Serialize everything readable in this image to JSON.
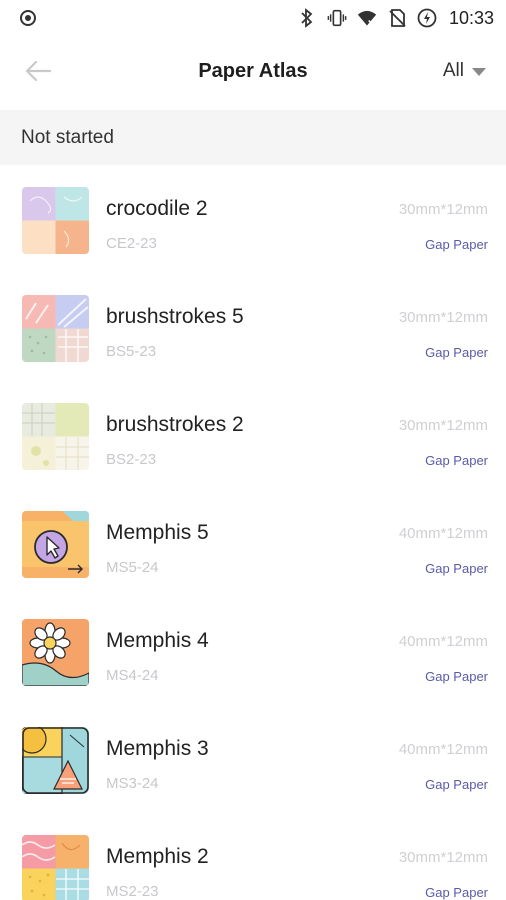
{
  "status_bar": {
    "time": "10:33",
    "icons": [
      "record-icon",
      "bluetooth-icon",
      "vibrate-icon",
      "wifi-icon",
      "no-sim-icon",
      "battery-charging-icon"
    ]
  },
  "header": {
    "title": "Paper Atlas",
    "filter_label": "All"
  },
  "section": {
    "title": "Not started"
  },
  "items": [
    {
      "name": "crocodile 2",
      "code": "CE2-23",
      "size": "30mm*12mm",
      "type": "Gap Paper",
      "thumb": "crocodile"
    },
    {
      "name": "brushstrokes 5",
      "code": "BS5-23",
      "size": "30mm*12mm",
      "type": "Gap Paper",
      "thumb": "brush5"
    },
    {
      "name": "brushstrokes 2",
      "code": "BS2-23",
      "size": "30mm*12mm",
      "type": "Gap Paper",
      "thumb": "brush2"
    },
    {
      "name": "Memphis 5",
      "code": "MS5-24",
      "size": "40mm*12mm",
      "type": "Gap Paper",
      "thumb": "memphis5"
    },
    {
      "name": "Memphis 4",
      "code": "MS4-24",
      "size": "40mm*12mm",
      "type": "Gap Paper",
      "thumb": "memphis4"
    },
    {
      "name": "Memphis 3",
      "code": "MS3-24",
      "size": "40mm*12mm",
      "type": "Gap Paper",
      "thumb": "memphis3"
    },
    {
      "name": "Memphis 2",
      "code": "MS2-23",
      "size": "30mm*12mm",
      "type": "Gap Paper",
      "thumb": "memphis2"
    }
  ],
  "colors": {
    "section_bg": "#f5f5f5",
    "type_text": "#5a5aa8",
    "muted_text": "#c8c8cc"
  }
}
